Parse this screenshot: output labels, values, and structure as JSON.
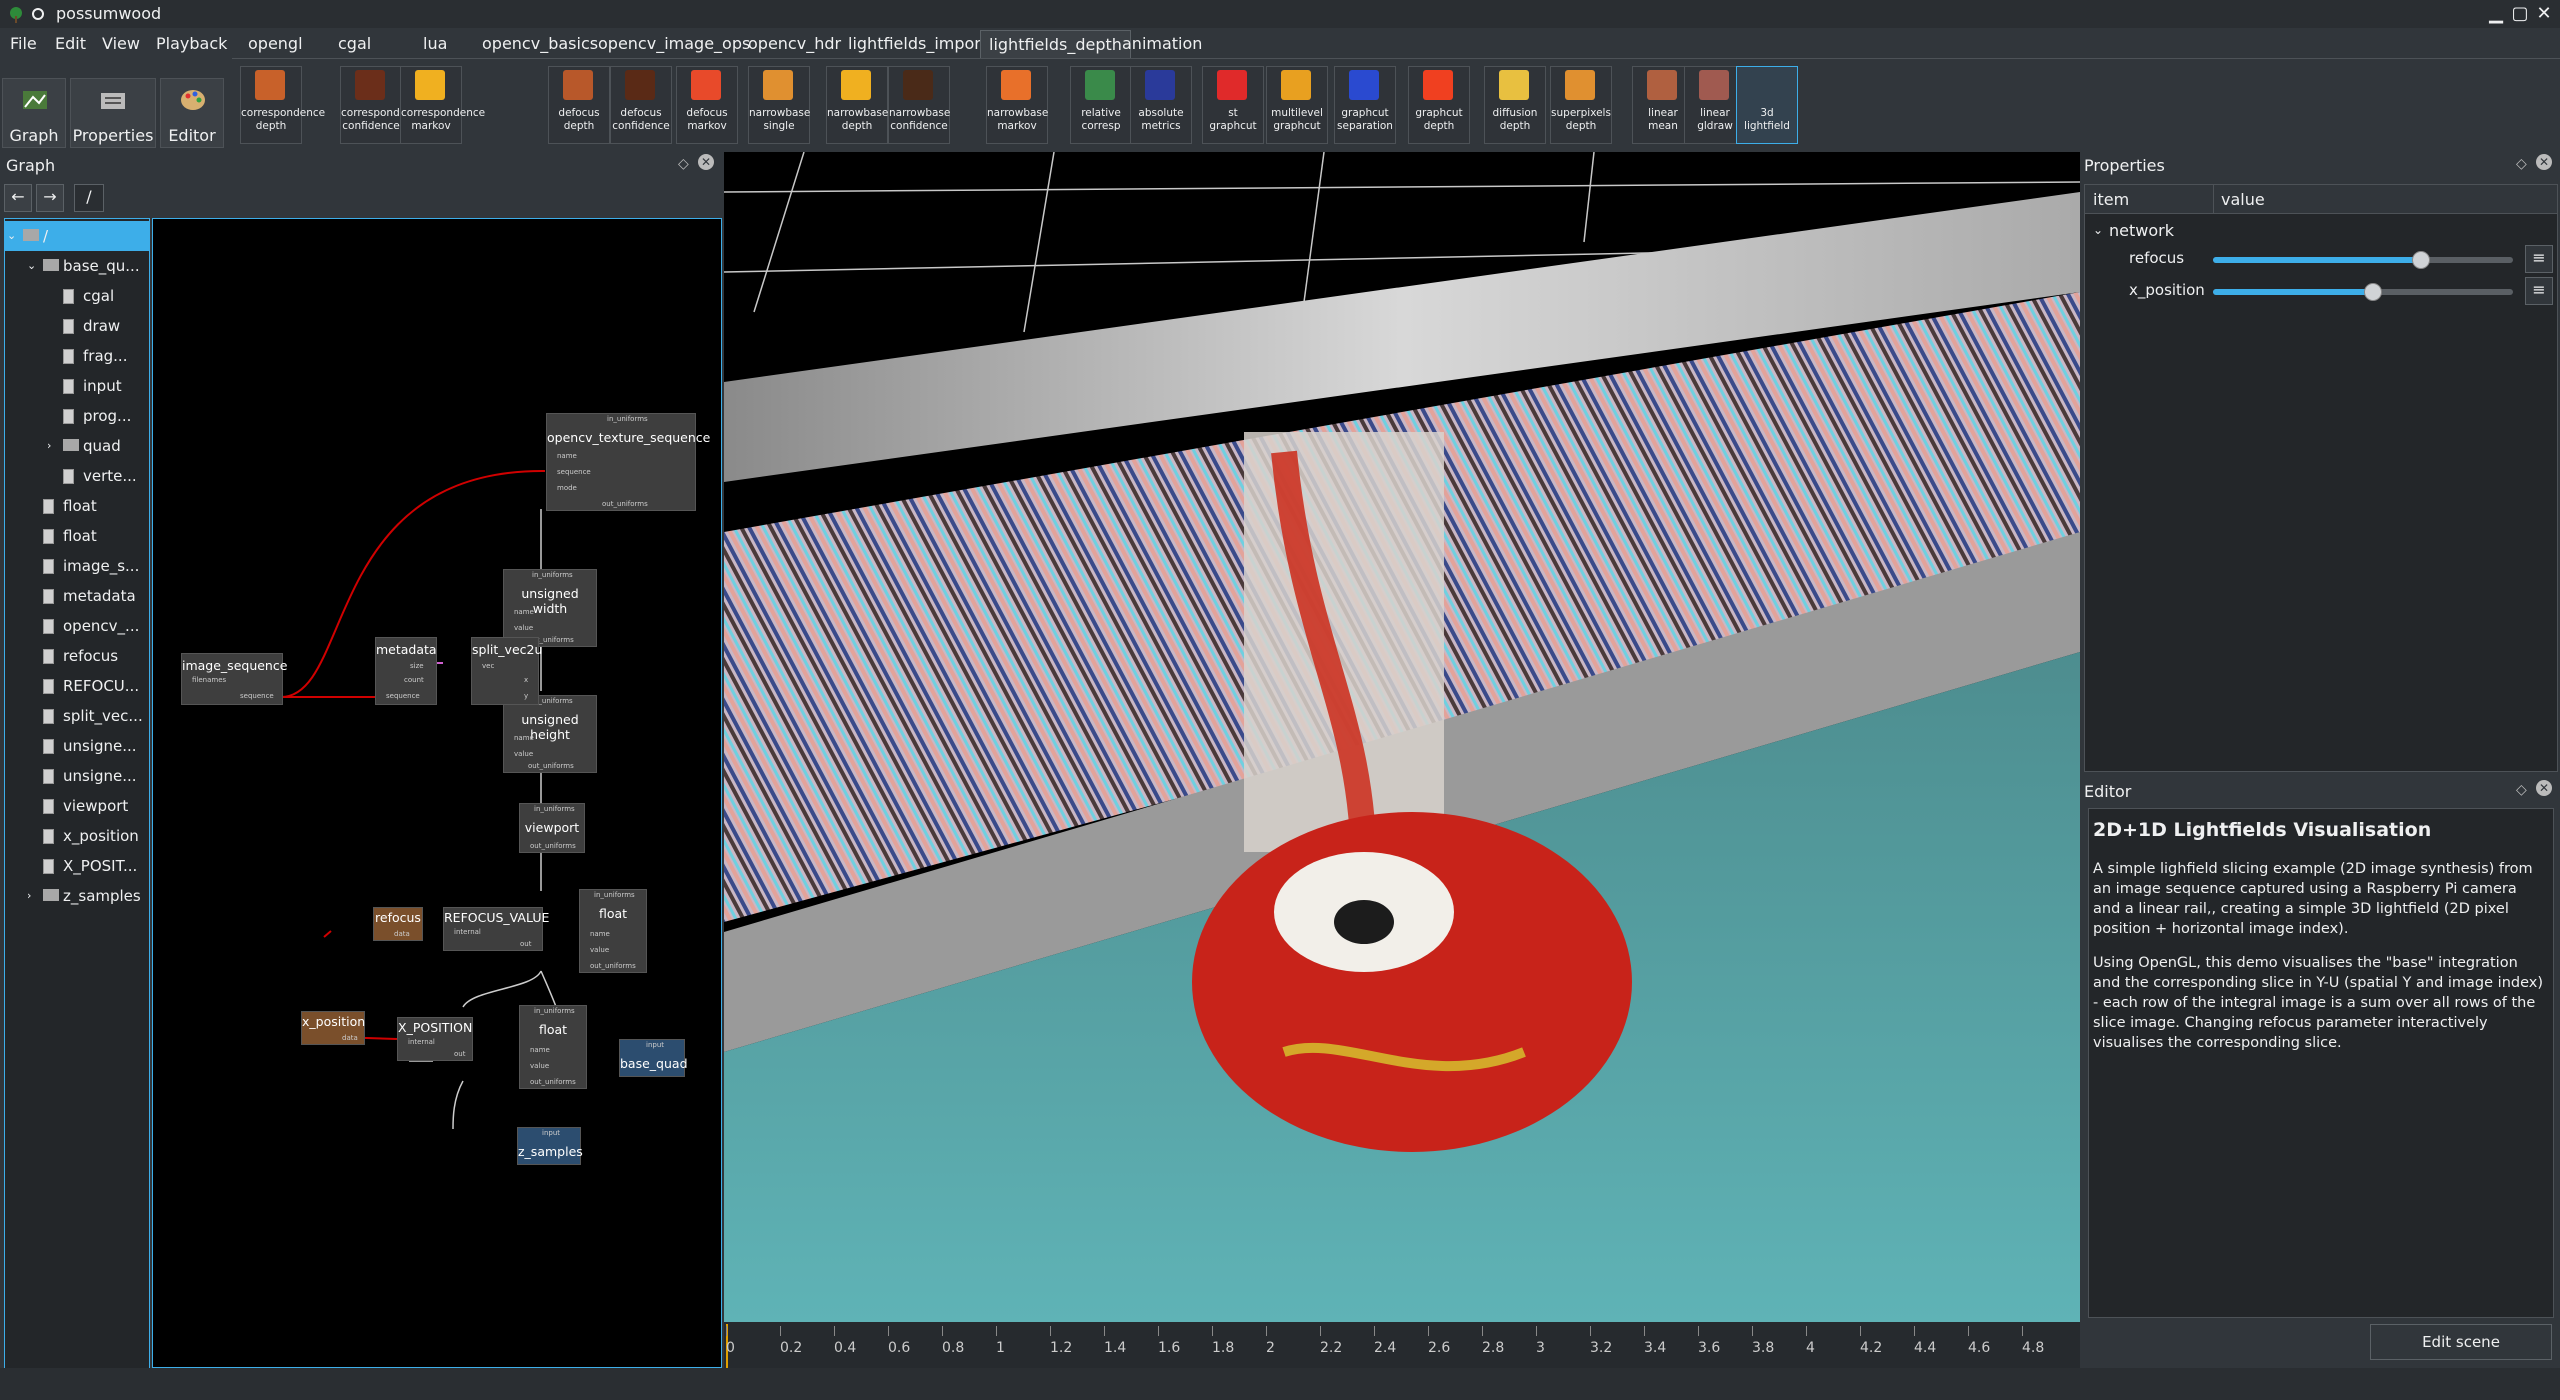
{
  "window": {
    "title": "possumwood",
    "minimize": "▁",
    "maximize": "▢",
    "close": "✕"
  },
  "menu": [
    "File",
    "Edit",
    "View",
    "Playback"
  ],
  "tabs": [
    "opengl",
    "cgal",
    "lua",
    "opencv_basics",
    "opencv_image_ops",
    "opencv_hdr",
    "lightfields_import",
    "lightfields_depth",
    "animation"
  ],
  "active_tab": "lightfields_depth",
  "mode_buttons": [
    "Graph",
    "Properties",
    "Editor"
  ],
  "tools": [
    {
      "l1": "correspondence",
      "l2": "depth",
      "color": "#c8612a"
    },
    {
      "l1": "correspondence",
      "l2": "confidence",
      "color": "#6b2e1a"
    },
    {
      "l1": "correspondence",
      "l2": "markov",
      "color": "#f0b020"
    },
    {
      "l1": "defocus",
      "l2": "depth",
      "color": "#b8582a"
    },
    {
      "l1": "defocus",
      "l2": "confidence",
      "color": "#5a2a16"
    },
    {
      "l1": "defocus",
      "l2": "markov",
      "color": "#e84a2a"
    },
    {
      "l1": "narrowbase",
      "l2": "single",
      "color": "#e09030"
    },
    {
      "l1": "narrowbase",
      "l2": "depth",
      "color": "#f0b020"
    },
    {
      "l1": "narrowbase",
      "l2": "confidence",
      "color": "#4a2a18"
    },
    {
      "l1": "narrowbase",
      "l2": "markov",
      "color": "#e8702a"
    },
    {
      "l1": "relative",
      "l2": "corresp",
      "color": "#3a8a4a"
    },
    {
      "l1": "absolute",
      "l2": "metrics",
      "color": "#2a3a9a"
    },
    {
      "l1": "st",
      "l2": "graphcut",
      "color": "#e02a2a"
    },
    {
      "l1": "multilevel",
      "l2": "graphcut",
      "color": "#e8a020"
    },
    {
      "l1": "graphcut",
      "l2": "separation",
      "color": "#2a4ad0"
    },
    {
      "l1": "graphcut",
      "l2": "depth",
      "color": "#f04020"
    },
    {
      "l1": "diffusion",
      "l2": "depth",
      "color": "#e8c040"
    },
    {
      "l1": "superpixels",
      "l2": "depth",
      "color": "#e09030"
    },
    {
      "l1": "linear",
      "l2": "mean",
      "color": "#b06040"
    },
    {
      "l1": "linear",
      "l2": "gldraw",
      "color": "#a05a50"
    },
    {
      "l1": "3d",
      "l2": "lightfield",
      "color": "#33424f"
    }
  ],
  "graph": {
    "title": "Graph",
    "path": "/",
    "back": "←",
    "forward": "→",
    "tree": [
      {
        "label": "/",
        "depth": 0,
        "type": "root"
      },
      {
        "label": "base_qu...",
        "depth": 1,
        "type": "folder",
        "expanded": true
      },
      {
        "label": "cgal",
        "depth": 2,
        "type": "file"
      },
      {
        "label": "draw",
        "depth": 2,
        "type": "file"
      },
      {
        "label": "frag...",
        "depth": 2,
        "type": "file"
      },
      {
        "label": "input",
        "depth": 2,
        "type": "file"
      },
      {
        "label": "prog...",
        "depth": 2,
        "type": "file"
      },
      {
        "label": "quad",
        "depth": 2,
        "type": "folder"
      },
      {
        "label": "verte...",
        "depth": 2,
        "type": "file"
      },
      {
        "label": "float",
        "depth": 1,
        "type": "file"
      },
      {
        "label": "float",
        "depth": 1,
        "type": "file"
      },
      {
        "label": "image_s...",
        "depth": 1,
        "type": "file"
      },
      {
        "label": "metadata",
        "depth": 1,
        "type": "file"
      },
      {
        "label": "opencv_...",
        "depth": 1,
        "type": "file"
      },
      {
        "label": "refocus",
        "depth": 1,
        "type": "file"
      },
      {
        "label": "REFOCU...",
        "depth": 1,
        "type": "file"
      },
      {
        "label": "split_vec...",
        "depth": 1,
        "type": "file"
      },
      {
        "label": "unsigne...",
        "depth": 1,
        "type": "file"
      },
      {
        "label": "unsigne...",
        "depth": 1,
        "type": "file"
      },
      {
        "label": "viewport",
        "depth": 1,
        "type": "file"
      },
      {
        "label": "x_position",
        "depth": 1,
        "type": "file"
      },
      {
        "label": "X_POSIT...",
        "depth": 1,
        "type": "file"
      },
      {
        "label": "z_samples",
        "depth": 1,
        "type": "folder"
      }
    ],
    "nodes": {
      "opencv_texture_sequence": {
        "title": "opencv_texture_sequence",
        "in": "in_uniforms",
        "p1": "name",
        "p2": "sequence",
        "p3": "mode",
        "out": "out_uniforms"
      },
      "unsigned_width": {
        "title": "unsigned width",
        "in": "in_uniforms",
        "p1": "name",
        "p2": "value",
        "out": "out_uniforms"
      },
      "unsigned_height": {
        "title": "unsigned height",
        "in": "in_uniforms",
        "p1": "name",
        "p2": "value",
        "out": "out_uniforms"
      },
      "viewport": {
        "title": "viewport",
        "in": "in_uniforms",
        "out": "out_uniforms"
      },
      "float1": {
        "title": "float",
        "in": "in_uniforms",
        "p1": "name",
        "p2": "value",
        "out": "out_uniforms"
      },
      "float2": {
        "title": "float",
        "in": "in_uniforms",
        "p1": "name",
        "p2": "value",
        "out": "out_uniforms"
      },
      "image_sequence": {
        "title": "image_sequence",
        "p1": "filenames",
        "out": "sequence"
      },
      "metadata": {
        "title": "metadata",
        "p1": "size",
        "p2": "count",
        "p3": "sequence"
      },
      "split_vec2u": {
        "title": "split_vec2u",
        "p1": "vec",
        "p2": "x",
        "p3": "y"
      },
      "refocus": {
        "title": "refocus",
        "p1": "data"
      },
      "refocus_value": {
        "title": "REFOCUS_VALUE",
        "p1": "internal",
        "out": "out"
      },
      "x_position": {
        "title": "x_position",
        "p1": "data"
      },
      "x_position_const": {
        "title": "X_POSITION",
        "p1": "internal",
        "out": "out"
      },
      "base_quad": {
        "title": "base_quad",
        "in": "input"
      },
      "z_samples": {
        "title": "z_samples",
        "in": "input"
      }
    }
  },
  "timeline": {
    "ticks": [
      "0",
      "0.2",
      "0.4",
      "0.6",
      "0.8",
      "1",
      "1.2",
      "1.4",
      "1.6",
      "1.8",
      "2",
      "2.2",
      "2.4",
      "2.6",
      "2.8",
      "3",
      "3.2",
      "3.4",
      "3.6",
      "3.8",
      "4",
      "4.2",
      "4.4",
      "4.6",
      "4.8"
    ]
  },
  "properties": {
    "title": "Properties",
    "col_item": "item",
    "col_value": "value",
    "group": "network",
    "rows": [
      {
        "label": "refocus",
        "fraction": 0.69
      },
      {
        "label": "x_position",
        "fraction": 0.53
      }
    ],
    "menu_glyph": "≡"
  },
  "editor": {
    "title": "Editor",
    "heading": "2D+1D Lightfields Visualisation",
    "p1": "A simple lighfield slicing example (2D image synthesis) from an image sequence captured using a Raspberry Pi camera and a linear rail,, creating a simple 3D lightfield (2D pixel position + horizontal image index).",
    "p2": "Using OpenGL, this demo visualises the \"base\" integration and the corresponding slice in Y-U (spatial Y and image index) - each row of the integral image is a sum over all rows of the slice image. Changing refocus parameter interactively visualises the corresponding slice.",
    "button": "Edit scene description..."
  },
  "colors": {
    "accent": "#3daee9",
    "panel": "#31363b",
    "dark": "#232629",
    "link": "#d00000"
  }
}
